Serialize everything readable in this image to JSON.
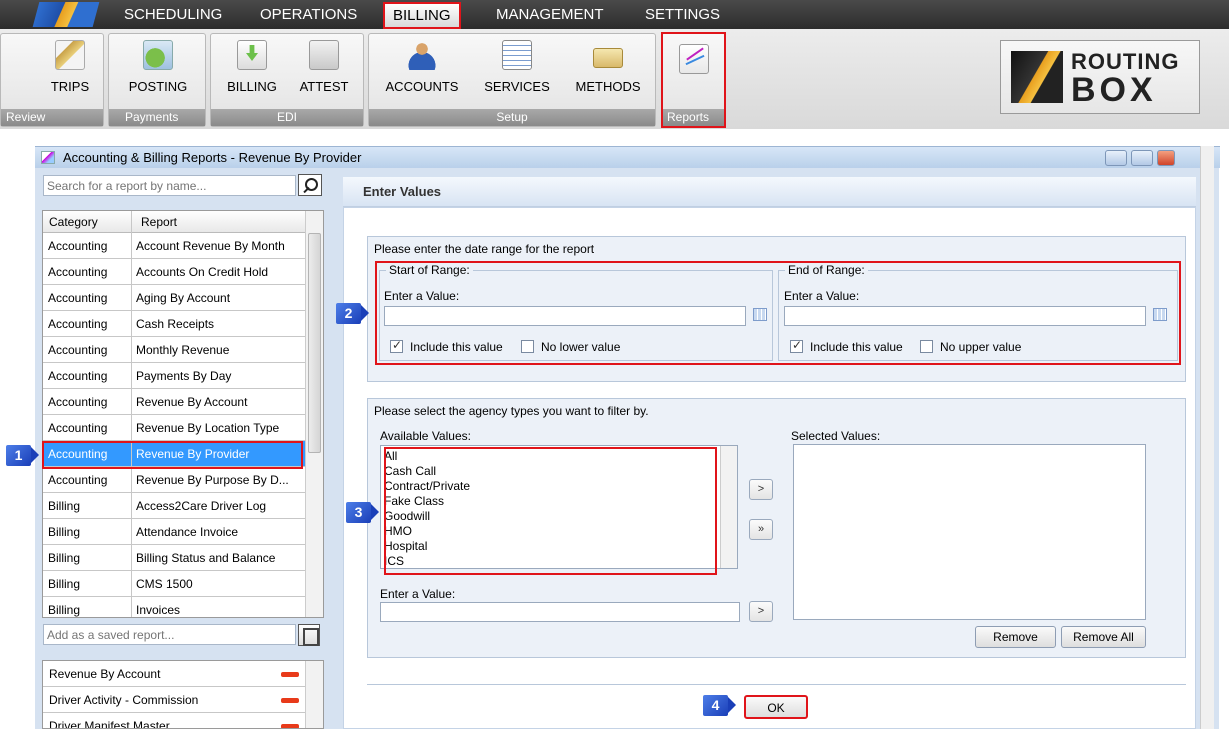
{
  "menu": {
    "items": [
      "SCHEDULING",
      "OPERATIONS",
      "BILLING",
      "MANAGEMENT",
      "SETTINGS"
    ],
    "active": "BILLING"
  },
  "ribbon": {
    "groups": [
      {
        "label": "Review",
        "buttons": [
          {
            "label": "TRIPS",
            "icon": "trips-icon"
          }
        ]
      },
      {
        "label": "Payments",
        "buttons": [
          {
            "label": "POSTING",
            "icon": "posting-icon"
          }
        ]
      },
      {
        "label": "EDI",
        "buttons": [
          {
            "label": "BILLING",
            "icon": "billing-icon"
          },
          {
            "label": "ATTEST",
            "icon": "attest-icon"
          }
        ]
      },
      {
        "label": "Setup",
        "buttons": [
          {
            "label": "ACCOUNTS",
            "icon": "accounts-icon"
          },
          {
            "label": "SERVICES",
            "icon": "services-icon"
          },
          {
            "label": "METHODS",
            "icon": "methods-icon"
          }
        ]
      },
      {
        "label": "Reports",
        "buttons": [
          {
            "label": "",
            "icon": "reports-chart-icon"
          }
        ]
      }
    ]
  },
  "brand": {
    "line1": "ROUTING",
    "line2": "BOX"
  },
  "window": {
    "title": "Accounting & Billing Reports - Revenue By Provider"
  },
  "left": {
    "search_placeholder": "Search for a report by name...",
    "columns": [
      "Category",
      "Report"
    ],
    "rows": [
      {
        "category": "Accounting",
        "report": "Account Revenue By Month"
      },
      {
        "category": "Accounting",
        "report": "Accounts On Credit Hold"
      },
      {
        "category": "Accounting",
        "report": "Aging By Account"
      },
      {
        "category": "Accounting",
        "report": "Cash Receipts"
      },
      {
        "category": "Accounting",
        "report": "Monthly Revenue"
      },
      {
        "category": "Accounting",
        "report": "Payments By Day"
      },
      {
        "category": "Accounting",
        "report": "Revenue By Account"
      },
      {
        "category": "Accounting",
        "report": "Revenue By Location Type"
      },
      {
        "category": "Accounting",
        "report": "Revenue By Provider"
      },
      {
        "category": "Accounting",
        "report": "Revenue By Purpose By D..."
      },
      {
        "category": "Billing",
        "report": "Access2Care Driver Log"
      },
      {
        "category": "Billing",
        "report": "Attendance Invoice"
      },
      {
        "category": "Billing",
        "report": "Billing Status and Balance"
      },
      {
        "category": "Billing",
        "report": "CMS 1500"
      },
      {
        "category": "Billing",
        "report": "Invoices"
      }
    ],
    "selected_index": 8,
    "saved_placeholder": "Add as a saved report...",
    "saved": [
      "Revenue By Account",
      "Driver Activity - Commission",
      "Driver Manifest Master"
    ]
  },
  "main": {
    "header": "Enter Values",
    "date_section": {
      "title": "Please enter the date range for the report",
      "start": {
        "legend": "Start of Range:",
        "label": "Enter a Value:",
        "value": "",
        "include_label": "Include this value",
        "include_checked": true,
        "none_label": "No lower value",
        "none_checked": false
      },
      "end": {
        "legend": "End of Range:",
        "label": "Enter a Value:",
        "value": "",
        "include_label": "Include this value",
        "include_checked": true,
        "none_label": "No upper value",
        "none_checked": false
      }
    },
    "agency_section": {
      "title": "Please select the agency types you want to filter by.",
      "available_label": "Available Values:",
      "available": [
        "All",
        "Cash Call",
        "Contract/Private",
        "Fake Class",
        "Goodwill",
        "HMO",
        "Hospital",
        "ICS"
      ],
      "selected_label": "Selected Values:",
      "selected": [],
      "enter_label": "Enter a Value:",
      "enter_value": "",
      "add_one": ">",
      "add_all": "»",
      "remove": "Remove",
      "remove_all": "Remove All"
    },
    "ok": "OK"
  },
  "badges": [
    "1",
    "2",
    "3",
    "4"
  ],
  "colors": {
    "highlight": "#e0141a",
    "badge": "#2a55d0",
    "selection": "#3399ff"
  }
}
